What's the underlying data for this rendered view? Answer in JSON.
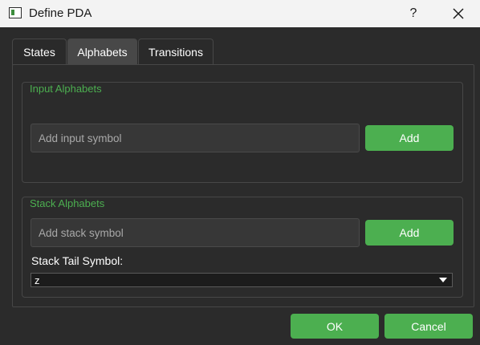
{
  "window": {
    "title": "Define PDA",
    "help_label": "?"
  },
  "tabs": [
    {
      "label": "States",
      "active": false
    },
    {
      "label": "Alphabets",
      "active": true
    },
    {
      "label": "Transitions",
      "active": false
    }
  ],
  "input_group": {
    "title": "Input Alphabets",
    "input_placeholder": "Add input symbol",
    "input_value": "",
    "add_label": "Add"
  },
  "stack_group": {
    "title": "Stack Alphabets",
    "input_placeholder": "Add stack symbol",
    "input_value": "",
    "add_label": "Add",
    "tail_label": "Stack Tail Symbol:",
    "tail_value": "z"
  },
  "footer": {
    "ok_label": "OK",
    "cancel_label": "Cancel"
  },
  "colors": {
    "accent_green": "#4caf50",
    "background": "#2b2b2b",
    "titlebar": "#f3f3f3"
  },
  "icons": {
    "app": "window-icon",
    "help": "question-mark",
    "close": "close-icon",
    "dropdown": "chevron-down-icon"
  }
}
